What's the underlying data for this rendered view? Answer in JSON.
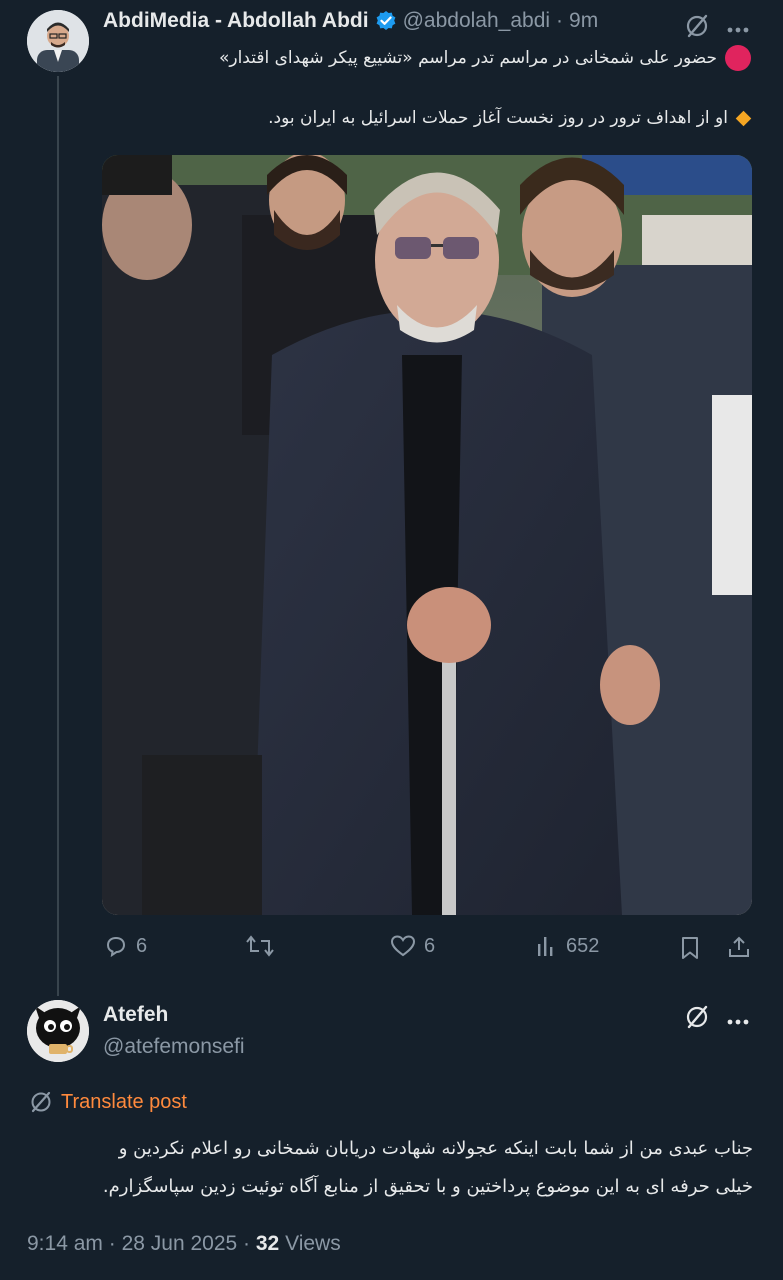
{
  "tweet": {
    "author_name": "AbdiMedia - Abdollah Abdi",
    "handle": "@abdolah_abdi",
    "separator": "·",
    "time": "9m",
    "line1_text": "حضور علی شمخانی در مراسم تدر مراسم «تشییع پیکر شهدای اقتدار»",
    "line2_text": "او از اهداف ترور در روز نخست آغاز حملات اسرائیل به ایران بود.",
    "actions": {
      "replies": "6",
      "likes": "6",
      "views": "652"
    }
  },
  "reply": {
    "author_name": "Atefeh",
    "handle": "@atefemonsefi",
    "translate_label": "Translate post",
    "text_line1": "جناب عبدی من از شما بابت اینکه عجولانه شهادت دریابان شمخانی رو اعلام نکردین و",
    "text_line2": "خیلی حرفه ای به این موضوع پرداختین و با تحقیق از منابع آگاه توئیت زدین سپاسگزارم.",
    "time": "9:14 am",
    "date": "28 Jun 2025",
    "views_count": "32",
    "views_label": "Views",
    "separator": "·"
  },
  "colors": {
    "background": "#15202b",
    "text": "#e7e9ea",
    "muted": "#8b98a5",
    "verified": "#1d9bf0",
    "translate": "#ff8a3d",
    "red_circle": "#e0245e",
    "diamond": "#f5a623"
  }
}
